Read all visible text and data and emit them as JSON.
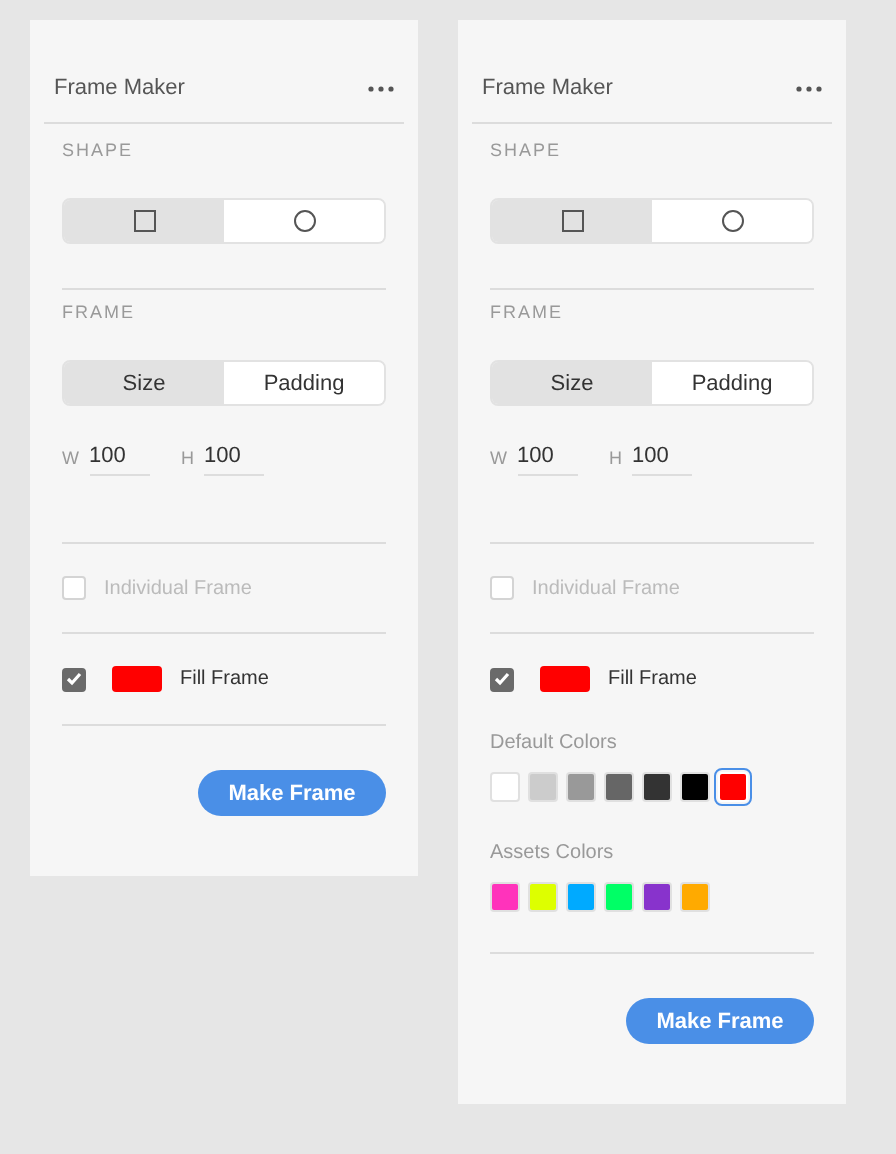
{
  "panels": [
    {
      "title": "Frame Maker",
      "shape": {
        "label": "SHAPE",
        "options": [
          {
            "kind": "square",
            "selected": true
          },
          {
            "kind": "circle",
            "selected": false
          }
        ]
      },
      "frame": {
        "label": "FRAME",
        "tabs": [
          {
            "label": "Size",
            "selected": true
          },
          {
            "label": "Padding",
            "selected": false
          }
        ],
        "fields": [
          {
            "label": "W",
            "value": "100"
          },
          {
            "label": "H",
            "value": "100"
          }
        ]
      },
      "individual_frame": {
        "label": "Individual Frame",
        "checked": false,
        "disabled": true
      },
      "fill_frame": {
        "label": "Fill Frame",
        "checked": true,
        "color": "#ff0000"
      },
      "button": "Make Frame"
    },
    {
      "title": "Frame Maker",
      "shape": {
        "label": "SHAPE",
        "options": [
          {
            "kind": "square",
            "selected": true
          },
          {
            "kind": "circle",
            "selected": false
          }
        ]
      },
      "frame": {
        "label": "FRAME",
        "tabs": [
          {
            "label": "Size",
            "selected": true
          },
          {
            "label": "Padding",
            "selected": false
          }
        ],
        "fields": [
          {
            "label": "W",
            "value": "100"
          },
          {
            "label": "H",
            "value": "100"
          }
        ]
      },
      "individual_frame": {
        "label": "Individual Frame",
        "checked": false,
        "disabled": true
      },
      "fill_frame": {
        "label": "Fill Frame",
        "checked": true,
        "color": "#ff0000"
      },
      "palettes": [
        {
          "label": "Default Colors",
          "swatches": [
            {
              "color": "#ffffff",
              "selected": false
            },
            {
              "color": "#cccccc",
              "selected": false
            },
            {
              "color": "#999999",
              "selected": false
            },
            {
              "color": "#666666",
              "selected": false
            },
            {
              "color": "#333333",
              "selected": false
            },
            {
              "color": "#000000",
              "selected": false
            },
            {
              "color": "#ff0000",
              "selected": true
            }
          ]
        },
        {
          "label": "Assets Colors",
          "swatches": [
            {
              "color": "#ff33bb",
              "selected": false
            },
            {
              "color": "#ddff00",
              "selected": false
            },
            {
              "color": "#00aaff",
              "selected": false
            },
            {
              "color": "#00ff66",
              "selected": false
            },
            {
              "color": "#8833cc",
              "selected": false
            },
            {
              "color": "#ffaa00",
              "selected": false
            }
          ]
        }
      ],
      "button": "Make Frame"
    }
  ]
}
